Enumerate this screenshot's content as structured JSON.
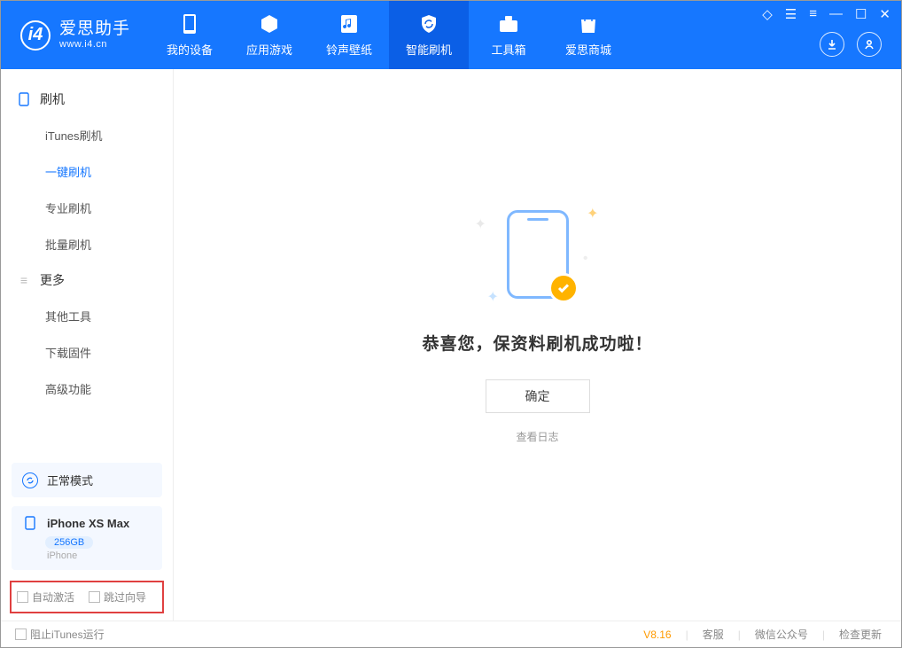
{
  "app": {
    "title": "爱思助手",
    "subtitle": "www.i4.cn"
  },
  "nav": {
    "tabs": [
      {
        "label": "我的设备",
        "icon": "phone"
      },
      {
        "label": "应用游戏",
        "icon": "cube"
      },
      {
        "label": "铃声壁纸",
        "icon": "note"
      },
      {
        "label": "智能刷机",
        "icon": "shield",
        "active": true
      },
      {
        "label": "工具箱",
        "icon": "toolbox"
      },
      {
        "label": "爱思商城",
        "icon": "bag"
      }
    ]
  },
  "sidebar": {
    "section1_label": "刷机",
    "items1": [
      {
        "label": "iTunes刷机"
      },
      {
        "label": "一键刷机",
        "active": true
      },
      {
        "label": "专业刷机"
      },
      {
        "label": "批量刷机"
      }
    ],
    "section2_label": "更多",
    "items2": [
      {
        "label": "其他工具"
      },
      {
        "label": "下载固件"
      },
      {
        "label": "高级功能"
      }
    ],
    "mode_label": "正常模式",
    "device": {
      "name": "iPhone XS Max",
      "storage": "256GB",
      "type": "iPhone"
    },
    "checkbox1": "自动激活",
    "checkbox2": "跳过向导"
  },
  "main": {
    "success_text": "恭喜您，保资料刷机成功啦！",
    "ok_button": "确定",
    "view_log": "查看日志"
  },
  "footer": {
    "block_itunes": "阻止iTunes运行",
    "version": "V8.16",
    "links": [
      "客服",
      "微信公众号",
      "检查更新"
    ]
  }
}
